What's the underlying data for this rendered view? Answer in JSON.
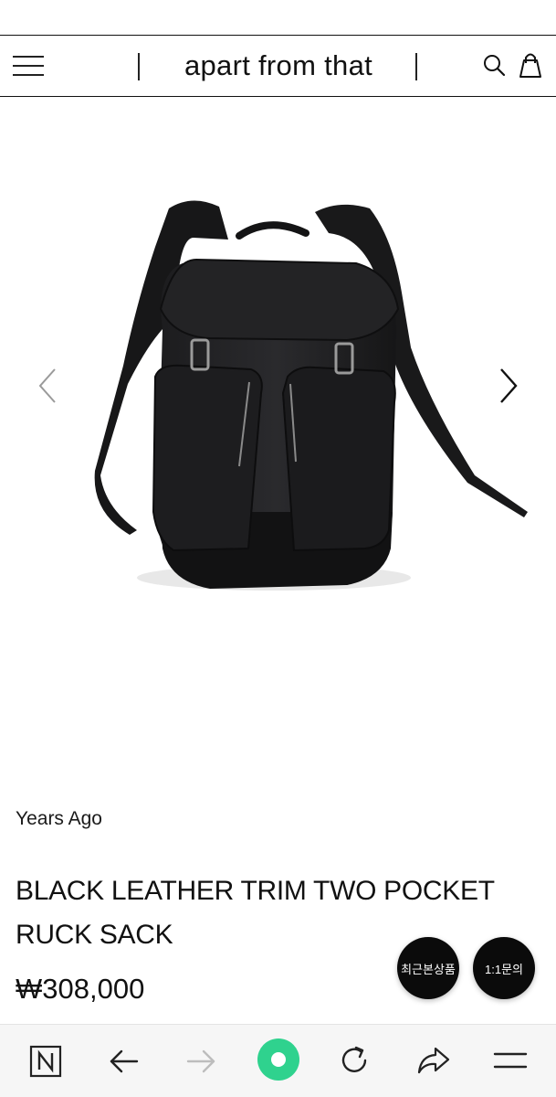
{
  "header": {
    "logo": "apart from that"
  },
  "product": {
    "brand": "Years Ago",
    "title": "BLACK LEATHER TRIM TWO POCKET RUCK SACK",
    "price": "₩308,000",
    "image_alt": "black backpack with leather trim and two front pockets"
  },
  "floating": {
    "recent_label": "최근본상품",
    "inquiry_label": "1:1문의"
  },
  "browser_bar": {
    "items": [
      "naver-home",
      "back",
      "forward",
      "green-home",
      "reload",
      "share",
      "menu"
    ],
    "accent_color": "#2fd28e"
  }
}
